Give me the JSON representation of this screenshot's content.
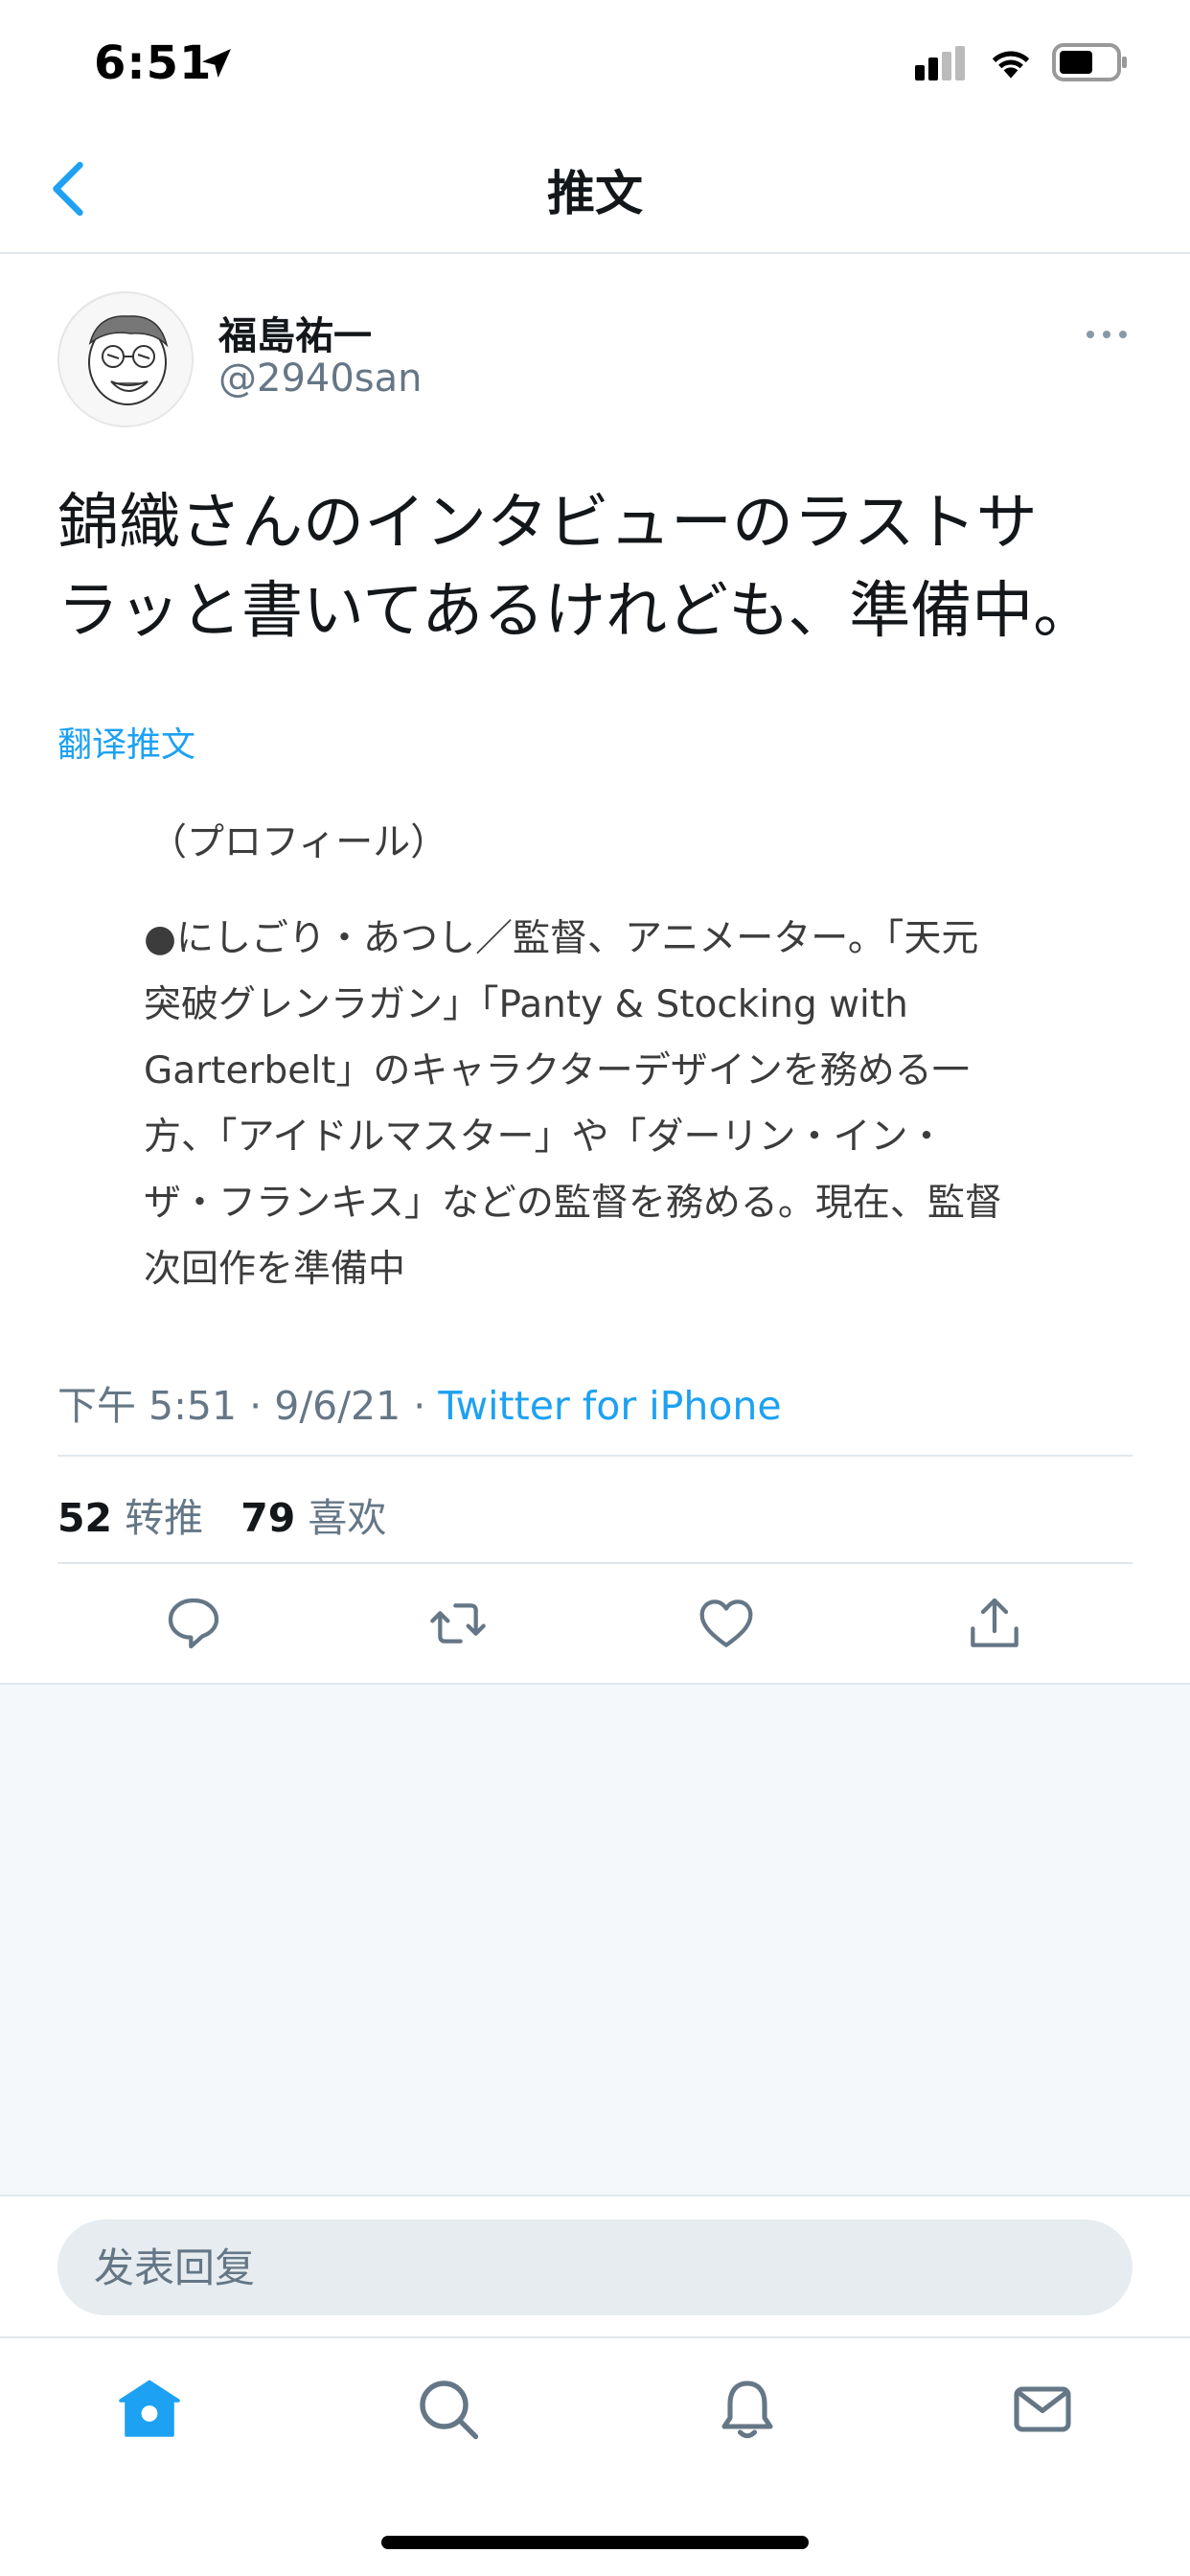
{
  "status_bar": {
    "time": "6:51"
  },
  "nav": {
    "title": "推文"
  },
  "tweet": {
    "author_name": "福島祐一",
    "author_handle": "@2940san",
    "text_lines": [
      "錦織さんのインタビューのラストサ",
      "ラッと書いてあるけれども、準備中。"
    ],
    "translate_label": "翻译推文",
    "embedded_image_lines": [
      "（プロフィール）",
      "●にしごり・あつし／監督、アニメーター。「天元",
      "突破グレンラガン」「Panty & Stocking with",
      "Garterbelt」のキャラクターデザインを務める一",
      "方、「アイドルマスター」や「ダーリン・イン・",
      "ザ・フランキス」などの監督を務める。現在、監督",
      "次回作を準備中"
    ],
    "meta": {
      "time": "下午 5:51",
      "date": "9/6/21",
      "separator": "·",
      "source": "Twitter for iPhone"
    },
    "stats": {
      "retweets": "52",
      "retweets_label": "转推",
      "likes": "79",
      "likes_label": "喜欢"
    }
  },
  "reply": {
    "placeholder": "发表回复"
  },
  "colors": {
    "accent": "#1da1f2",
    "secondary_text": "#657786",
    "divider": "#e1e8ed",
    "background_gray": "#f5f8fa"
  },
  "icons": {
    "back": "chevron-left-icon",
    "more": "more-horizontal-icon",
    "reply": "reply-icon",
    "retweet": "retweet-icon",
    "like": "heart-icon",
    "share": "share-icon",
    "home": "home-icon",
    "search": "search-icon",
    "notifications": "bell-icon",
    "messages": "mail-icon"
  }
}
